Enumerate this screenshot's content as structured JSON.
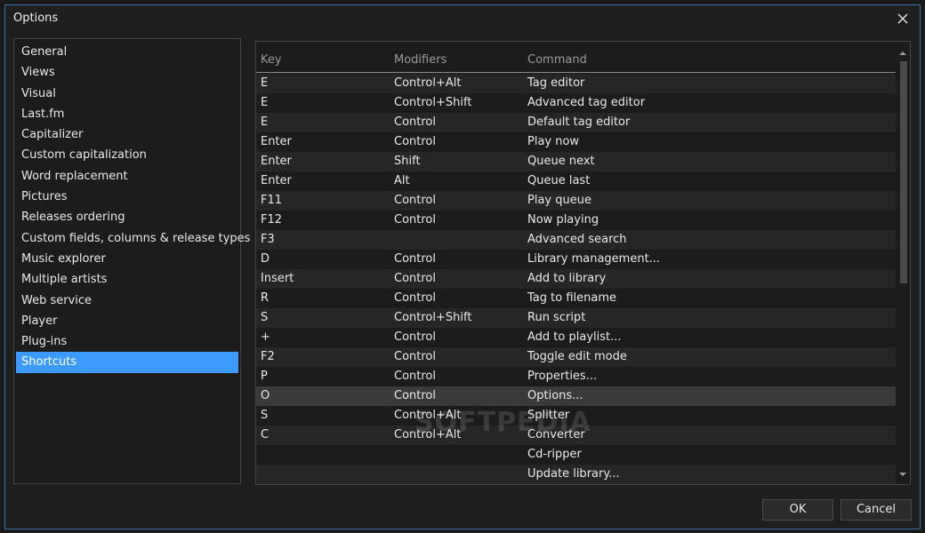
{
  "window": {
    "title": "Options"
  },
  "sidebar": {
    "items": [
      "General",
      "Views",
      "Visual",
      "Last.fm",
      "Capitalizer",
      "Custom capitalization",
      "Word replacement",
      "Pictures",
      "Releases ordering",
      "Custom fields, columns & release types",
      "Music explorer",
      "Multiple artists",
      "Web service",
      "Player",
      "Plug-ins",
      "Shortcuts"
    ],
    "selected": "Shortcuts"
  },
  "table": {
    "headers": {
      "key": "Key",
      "modifiers": "Modifiers",
      "command": "Command"
    },
    "rows": [
      {
        "key": "E",
        "modifiers": "Control+Alt",
        "command": "Tag editor"
      },
      {
        "key": "E",
        "modifiers": "Control+Shift",
        "command": "Advanced tag editor"
      },
      {
        "key": "E",
        "modifiers": "Control",
        "command": "Default tag editor"
      },
      {
        "key": "Enter",
        "modifiers": "Control",
        "command": "Play now"
      },
      {
        "key": "Enter",
        "modifiers": "Shift",
        "command": "Queue next"
      },
      {
        "key": "Enter",
        "modifiers": "Alt",
        "command": "Queue last"
      },
      {
        "key": "F11",
        "modifiers": "Control",
        "command": "Play queue"
      },
      {
        "key": "F12",
        "modifiers": "Control",
        "command": "Now playing"
      },
      {
        "key": "F3",
        "modifiers": "",
        "command": "Advanced search"
      },
      {
        "key": "D",
        "modifiers": "Control",
        "command": "Library management..."
      },
      {
        "key": "Insert",
        "modifiers": "Control",
        "command": "Add to library"
      },
      {
        "key": "R",
        "modifiers": "Control",
        "command": "Tag to filename"
      },
      {
        "key": "S",
        "modifiers": "Control+Shift",
        "command": "Run script"
      },
      {
        "key": "+",
        "modifiers": "Control",
        "command": "Add to playlist..."
      },
      {
        "key": "F2",
        "modifiers": "Control",
        "command": "Toggle edit mode"
      },
      {
        "key": "P",
        "modifiers": "Control",
        "command": "Properties..."
      },
      {
        "key": "O",
        "modifiers": "Control",
        "command": "Options..."
      },
      {
        "key": "S",
        "modifiers": "Control+Alt",
        "command": "Splitter"
      },
      {
        "key": "C",
        "modifiers": "Control+Alt",
        "command": "Converter"
      },
      {
        "key": "",
        "modifiers": "",
        "command": "Cd-ripper"
      },
      {
        "key": "",
        "modifiers": "",
        "command": "Update library..."
      }
    ],
    "highlighted_row": 16
  },
  "watermark": "SOFTPEDIA",
  "buttons": {
    "ok": "OK",
    "cancel": "Cancel"
  },
  "colors": {
    "accent": "#3d9bff",
    "window_border": "#3d6fa8",
    "background": "#1f1f1f"
  },
  "icons": {
    "close": "close-icon",
    "scroll_up": "chevron-up-icon",
    "scroll_down": "chevron-down-icon"
  }
}
